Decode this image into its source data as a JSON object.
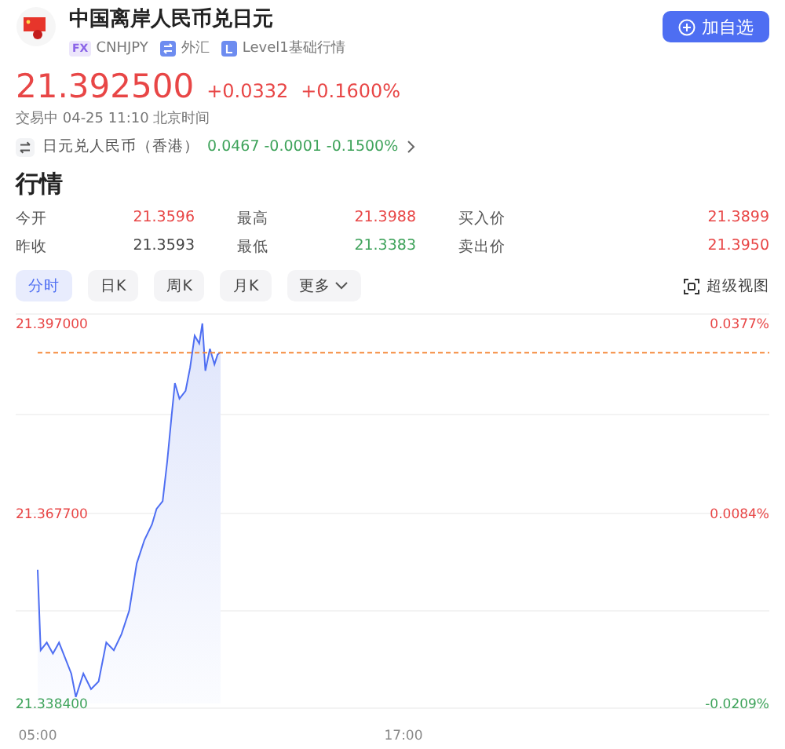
{
  "header": {
    "title": "中国离岸人民币兑日元",
    "tags": [
      {
        "kind": "fx",
        "badge": "FX",
        "text": "CNHJPY"
      },
      {
        "kind": "category",
        "text": "外汇"
      },
      {
        "kind": "level",
        "text": "Level1基础行情"
      }
    ],
    "watch_button": "加自选"
  },
  "quote": {
    "price": "21.392500",
    "change": "+0.0332",
    "change_pct": "+0.1600%",
    "color": "#e84646",
    "status": "交易中 04-25 11:10 北京时间"
  },
  "related": {
    "name": "日元兑人民币（香港）",
    "price": "0.0467",
    "change": "-0.0001",
    "change_pct": "-0.1500%",
    "color": "#3fa35b"
  },
  "market": {
    "title": "行情",
    "stats": [
      {
        "label": "今开",
        "value": "21.3596",
        "color": "#e84646"
      },
      {
        "label": "最高",
        "value": "21.3988",
        "color": "#e84646"
      },
      {
        "label": "买入价",
        "value": "21.3899",
        "color": "#e84646"
      },
      {
        "label": "昨收",
        "value": "21.3593",
        "color": "#444444"
      },
      {
        "label": "最低",
        "value": "21.3383",
        "color": "#3fa35b"
      },
      {
        "label": "卖出价",
        "value": "21.3950",
        "color": "#e84646"
      }
    ]
  },
  "tabs": [
    {
      "label": "分时",
      "selected": true,
      "kind": "plain"
    },
    {
      "label": "日K",
      "selected": false,
      "kind": "plain"
    },
    {
      "label": "周K",
      "selected": false,
      "kind": "plain"
    },
    {
      "label": "月K",
      "selected": false,
      "kind": "plain"
    },
    {
      "label": "更多",
      "selected": false,
      "kind": "menu"
    }
  ],
  "super_view": "超级视图",
  "chart": {
    "right_axis": [
      {
        "label": "0.0377%",
        "color": "#e84646"
      },
      {
        "label": "0.0084%",
        "color": "#e84646"
      },
      {
        "label": "-0.0209%",
        "color": "#3fa35b"
      }
    ],
    "chart_data": {
      "type": "line",
      "x": [
        5,
        5.1,
        5.3,
        5.5,
        5.7,
        5.9,
        6.1,
        6.25,
        6.5,
        6.75,
        7,
        7.25,
        7.5,
        7.75,
        8,
        8.25,
        8.5,
        8.75,
        8.9,
        9.1,
        9.25,
        9.4,
        9.5,
        9.65,
        9.85,
        10,
        10.15,
        10.3,
        10.4,
        10.5,
        10.65,
        10.8,
        10.9,
        11
      ],
      "series": [
        {
          "color": "#4e6ef2",
          "values": [
            21.359,
            21.3466,
            21.3478,
            21.3461,
            21.3478,
            21.3454,
            21.343,
            21.3394,
            21.343,
            21.3406,
            21.3418,
            21.3478,
            21.3466,
            21.3491,
            21.3527,
            21.36,
            21.3636,
            21.366,
            21.3684,
            21.3696,
            21.3757,
            21.383,
            21.3878,
            21.3854,
            21.3866,
            21.3902,
            21.3951,
            21.3939,
            21.397,
            21.3897,
            21.3931,
            21.3907,
            21.3922,
            21.3926
          ]
        }
      ],
      "ref_lines": [
        {
          "axis": "y",
          "value": 21.3925,
          "color": "#f58a3c"
        }
      ],
      "xlim": [
        5,
        29
      ],
      "ylim": [
        21.3384,
        21.397
      ],
      "xticks": [
        {
          "value": 5,
          "label": "05:00"
        },
        {
          "value": 17,
          "label": "17:00"
        }
      ],
      "yticks": [
        {
          "value": 21.397,
          "label": "21.397000"
        },
        {
          "value": 21.3677,
          "label": "21.367700"
        },
        {
          "value": 21.3384,
          "label": "21.338400"
        }
      ]
    }
  }
}
